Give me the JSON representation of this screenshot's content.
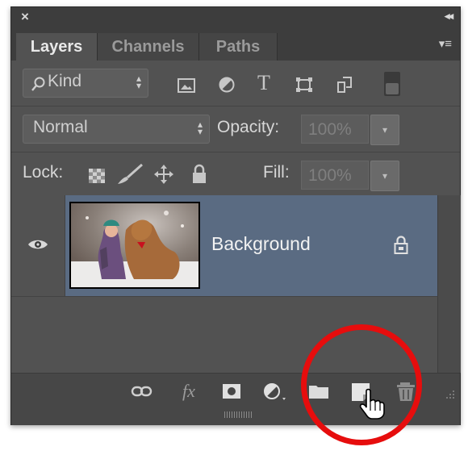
{
  "panel": {
    "close_glyph": "×",
    "collapse_glyph": "◂◂",
    "menu_glyph": "▾≡"
  },
  "tabs": [
    {
      "label": "Layers",
      "active": true
    },
    {
      "label": "Channels",
      "active": false
    },
    {
      "label": "Paths",
      "active": false
    }
  ],
  "filter": {
    "kind_label": "Kind",
    "icons": [
      "pixel-layer-filter-icon",
      "adjustment-layer-filter-icon",
      "type-layer-filter-icon",
      "shape-layer-filter-icon",
      "smart-object-filter-icon"
    ],
    "type_glyph": "T"
  },
  "blend": {
    "mode": "Normal",
    "opacity_label": "Opacity:",
    "opacity_value": "100%"
  },
  "lock": {
    "label": "Lock:",
    "fill_label": "Fill:",
    "fill_value": "100%"
  },
  "layers": [
    {
      "name": "Background",
      "visible": true,
      "locked": true,
      "selected": true
    }
  ],
  "footer": {
    "icons": [
      "link-layers-icon",
      "fx-icon",
      "add-mask-icon",
      "adjustment-layer-icon",
      "new-group-icon",
      "new-layer-icon",
      "delete-layer-icon"
    ],
    "fx_text": "fx"
  },
  "colors": {
    "panel_bg": "#525252",
    "selected_layer": "#5a6b82",
    "highlight_circle": "#e60d0d"
  }
}
